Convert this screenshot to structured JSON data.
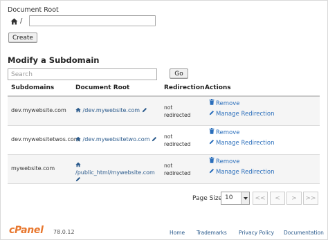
{
  "form": {
    "document_root_label": "Document Root",
    "path_prefix": "/",
    "document_root_value": "",
    "create_label": "Create"
  },
  "modify": {
    "heading": "Modify a Subdomain",
    "search_placeholder": "Search",
    "go_label": "Go"
  },
  "table": {
    "headers": {
      "subdomains": "Subdomains",
      "document_root": "Document Root",
      "redirection": "Redirection",
      "actions": "Actions"
    },
    "rows": [
      {
        "subdomain": "dev.mywebsite.com",
        "docroot_line1": "/dev.mywebsite.com",
        "docroot_line2": "",
        "redirect_line1": "not",
        "redirect_line2": "redirected",
        "remove": "Remove",
        "manage": "Manage Redirection"
      },
      {
        "subdomain": "dev.mywebsitetwos.com",
        "docroot_line1": "/dev.mywebsitetwo.com",
        "docroot_line2": "",
        "redirect_line1": "not",
        "redirect_line2": "redirected",
        "remove": "Remove",
        "manage": "Manage Redirection"
      },
      {
        "subdomain": "mywebsite.com",
        "docroot_line1": "/public_html/mywebsite.com",
        "docroot_line2": "",
        "redirect_line1": "not",
        "redirect_line2": "redirected",
        "remove": "Remove",
        "manage": "Manage Redirection"
      }
    ]
  },
  "pagination": {
    "page_size_label": "Page Size",
    "page_size_value": "10",
    "first": "<<",
    "prev": "<",
    "next": ">",
    "last": ">>"
  },
  "footer": {
    "logo": "cPanel",
    "version": "78.0.12",
    "links": [
      "Home",
      "Trademarks",
      "Privacy Policy",
      "Documentation"
    ]
  },
  "colors": {
    "link": "#2a6ebb",
    "brand": "#e8772e"
  },
  "icons": {
    "home": "home-icon",
    "edit": "pencil-icon",
    "remove": "trash-icon",
    "manage": "pencil-icon",
    "select": "chevron-down-icon"
  }
}
